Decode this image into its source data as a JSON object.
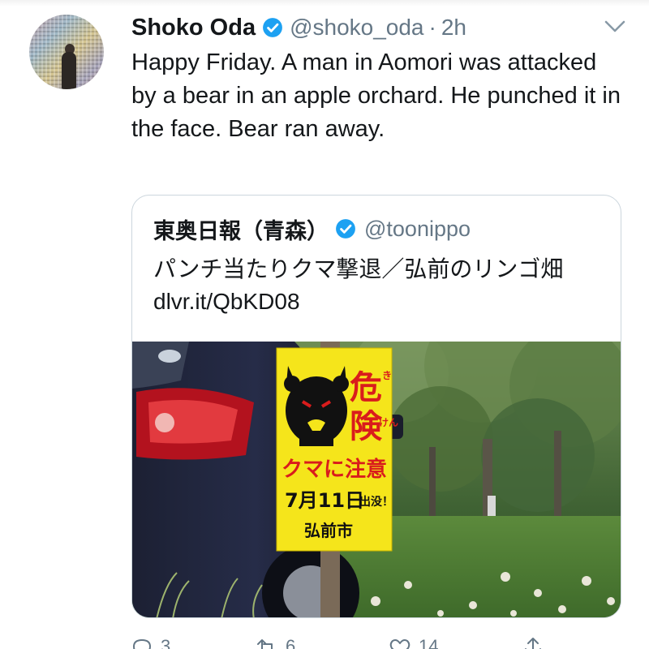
{
  "tweet": {
    "display_name": "Shoko Oda",
    "handle": "@shoko_oda",
    "separator": "·",
    "time": "2h",
    "text": "Happy Friday. A man in Aomori was attacked by a bear in an apple orchard. He punched it in the face. Bear ran away."
  },
  "quoted_tweet": {
    "display_name": "東奥日報（青森）",
    "handle": "@toonippo",
    "text": "パンチ当たりクマ撃退／弘前のリンゴ畑 dlvr.it/QbKD08"
  },
  "sign": {
    "danger_1": "危",
    "danger_2": "険",
    "furigana_1": "き",
    "furigana_2": "けん",
    "warning": "クマに注意",
    "date_number": "7月11日",
    "date_suffix": "出没！",
    "city": "弘前市"
  },
  "actions": {
    "reply_count": "3",
    "retweet_count": "6",
    "like_count": "14"
  },
  "colors": {
    "verified_blue": "#1da1f2",
    "muted_text": "#657786",
    "sign_yellow": "#f5e51b",
    "sign_red": "#d91c1c"
  },
  "icons": [
    "verified-icon",
    "chevron-down-icon",
    "reply-icon",
    "retweet-icon",
    "like-icon",
    "share-icon"
  ]
}
